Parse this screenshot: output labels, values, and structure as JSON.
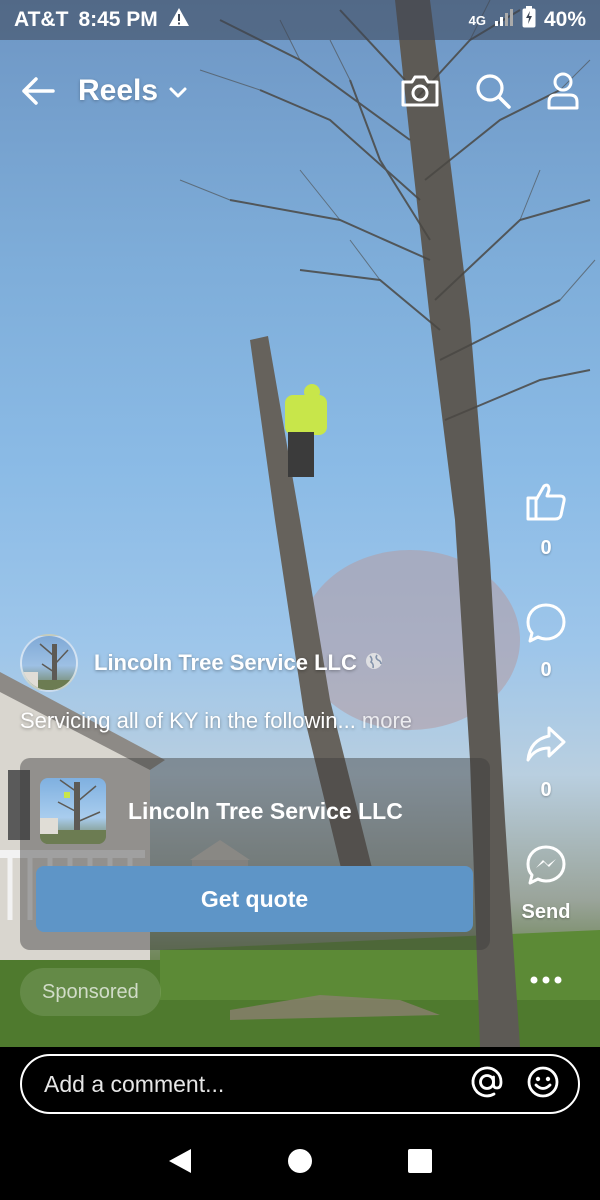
{
  "status_bar": {
    "carrier": "AT&T",
    "time": "8:45 PM",
    "network": "4G",
    "battery": "40%"
  },
  "top_bar": {
    "title": "Reels",
    "icons": [
      "back-arrow-icon",
      "chevron-down-icon",
      "camera-icon",
      "search-icon",
      "profile-icon"
    ]
  },
  "rail": {
    "like_count": "0",
    "comment_count": "0",
    "share_count": "0",
    "send_label": "Send"
  },
  "post": {
    "page_name": "Lincoln Tree Service LLC",
    "caption": "Servicing all of KY in the followin...",
    "more_label": "more"
  },
  "ad_card": {
    "advertiser": "Lincoln Tree Service LLC",
    "cta_label": "Get quote"
  },
  "sponsored_label": "Sponsored",
  "comment": {
    "placeholder": "Add a comment..."
  },
  "colors": {
    "cta": "#5e95c7",
    "sky": "#8bbbe6"
  }
}
